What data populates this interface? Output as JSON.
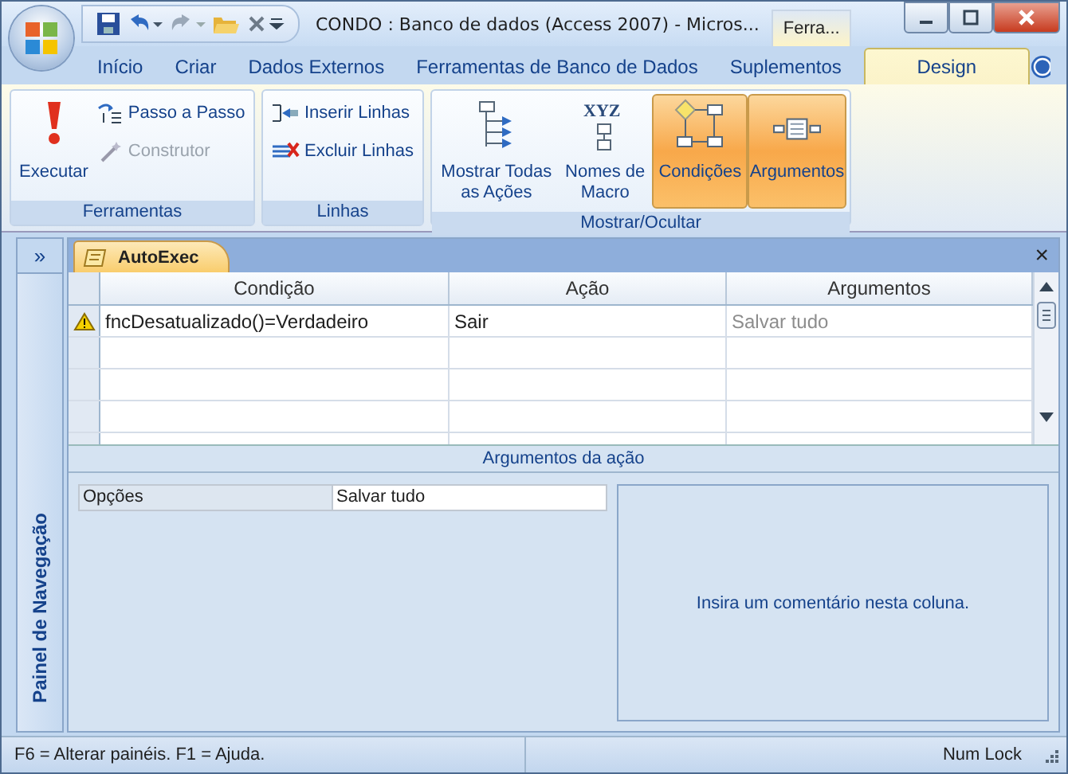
{
  "window": {
    "title": "CONDO : Banco de dados (Access 2007)  -  Micros...",
    "contextual_tab": "Ferra..."
  },
  "ribbon": {
    "tabs": [
      {
        "label": "Início",
        "selected": false
      },
      {
        "label": "Criar",
        "selected": false
      },
      {
        "label": "Dados Externos",
        "selected": false
      },
      {
        "label": "Ferramentas de Banco de Dados",
        "selected": false
      },
      {
        "label": "Suplementos",
        "selected": false
      },
      {
        "label": "Design",
        "selected": true
      }
    ],
    "groups": [
      {
        "label": "Ferramentas",
        "items": [
          {
            "kind": "large",
            "label": "Executar",
            "selected": false,
            "disabled": false
          },
          {
            "kind": "small",
            "label": "Passo a Passo",
            "selected": false,
            "disabled": false
          },
          {
            "kind": "small",
            "label": "Construtor",
            "selected": false,
            "disabled": true
          }
        ]
      },
      {
        "label": "Linhas",
        "items": [
          {
            "kind": "small",
            "label": "Inserir Linhas",
            "selected": false,
            "disabled": false
          },
          {
            "kind": "small",
            "label": "Excluir Linhas",
            "selected": false,
            "disabled": false
          }
        ]
      },
      {
        "label": "Mostrar/Ocultar",
        "items": [
          {
            "kind": "large",
            "label": "Mostrar Todas as Ações",
            "selected": false,
            "disabled": false
          },
          {
            "kind": "large",
            "label": "Nomes de Macro",
            "icon_text": "XYZ",
            "selected": false,
            "disabled": false
          },
          {
            "kind": "large",
            "label": "Condições",
            "selected": true,
            "disabled": false
          },
          {
            "kind": "large",
            "label": "Argumentos",
            "selected": true,
            "disabled": false
          }
        ]
      }
    ]
  },
  "navigation_pane": {
    "toggle": "»",
    "label": "Painel de Navegação"
  },
  "document": {
    "tab": {
      "label": "AutoExec"
    },
    "close": "×",
    "columns": [
      "Condição",
      "Ação",
      "Argumentos"
    ],
    "rows": [
      {
        "condition": "fncDesatualizado()=Verdadeiro",
        "action": "Sair",
        "arguments": "Salvar tudo",
        "warning": true
      }
    ]
  },
  "action_arguments": {
    "title": "Argumentos da ação",
    "fields": [
      {
        "label": "Opções",
        "value": "Salvar tudo"
      }
    ],
    "comment_hint": "Insira um comentário nesta coluna."
  },
  "status_bar": {
    "left": "F6 = Alterar painéis. F1 = Ajuda.",
    "right": "Num Lock"
  }
}
